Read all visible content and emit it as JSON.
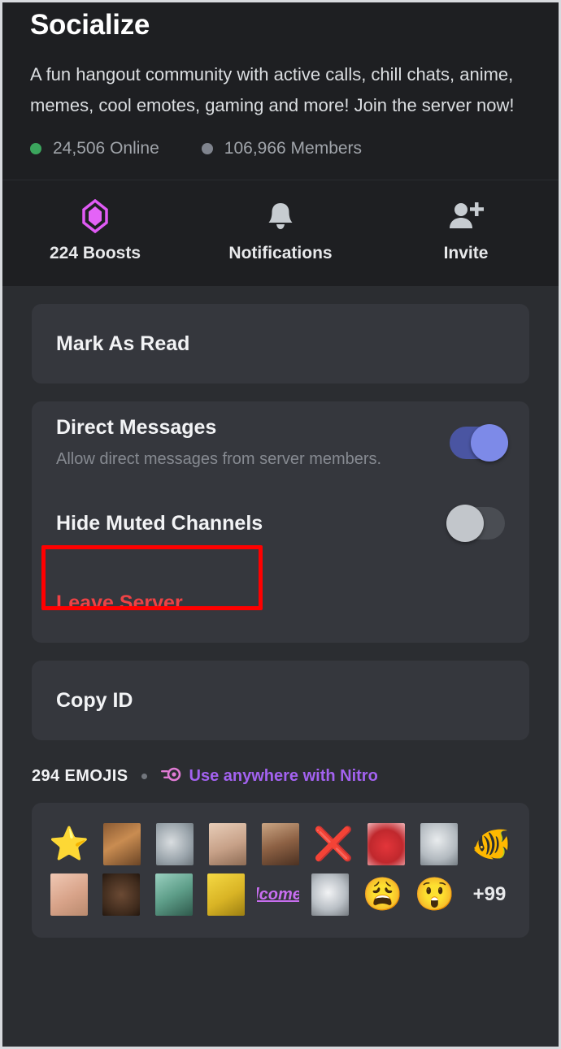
{
  "header": {
    "server_name": "Socialize",
    "description": "A fun hangout community with active calls, chill chats, anime, memes, cool emotes, gaming and more! Join the server now!",
    "stats": [
      {
        "icon": "online-dot-icon",
        "label": "24,506 Online",
        "color": "#3ba55d"
      },
      {
        "icon": "members-dot-icon",
        "label": "106,966 Members",
        "color": "#80848e"
      }
    ]
  },
  "actions": [
    {
      "icon": "boost-gem-icon",
      "label": "224 Boosts",
      "color": "#e05af5"
    },
    {
      "icon": "bell-icon",
      "label": "Notifications",
      "color": "#c7ccd1"
    },
    {
      "icon": "person-add-icon",
      "label": "Invite",
      "color": "#c7ccd1"
    }
  ],
  "settings": {
    "mark_as_read": {
      "label": "Mark As Read"
    },
    "direct_messages": {
      "label": "Direct Messages",
      "sublabel": "Allow direct messages from server members.",
      "toggle_state": "on"
    },
    "hide_muted_channels": {
      "label": "Hide Muted Channels",
      "toggle_state": "off"
    },
    "leave_server": {
      "label": "Leave Server",
      "color": "#ed4245",
      "highlight_color": "#ff0000"
    },
    "copy_id": {
      "label": "Copy ID"
    }
  },
  "emojis": {
    "count_label": "294 EMOJIS",
    "nitro_icon": "nitro-boost-icon",
    "nitro_label": "Use anywhere with Nitro",
    "more_label": "+99",
    "row1": [
      {
        "name": "star-emoji",
        "glyph": "⭐",
        "kind": "glyph"
      },
      {
        "name": "cat-emoji",
        "kind": "photo",
        "style": "ph-cat"
      },
      {
        "name": "fish-emoji",
        "kind": "photo",
        "style": "ph-fish"
      },
      {
        "name": "old-man-emoji",
        "kind": "photo",
        "style": "ph-oldman"
      },
      {
        "name": "smiling-man-emoji",
        "kind": "photo",
        "style": "ph-smile"
      },
      {
        "name": "red-x-emoji",
        "glyph": "❌",
        "kind": "glyph"
      },
      {
        "name": "elmo-emoji",
        "kind": "photo",
        "style": "ph-elmo"
      },
      {
        "name": "thomas-face-emoji",
        "kind": "photo",
        "style": "ph-thomas"
      },
      {
        "name": "clownfish-emoji",
        "glyph": "🐠",
        "kind": "glyph"
      }
    ],
    "row2": [
      {
        "name": "squinting-face-emoji",
        "kind": "photo",
        "style": "ph-eyes"
      },
      {
        "name": "confused-nick-young-emoji",
        "kind": "photo",
        "style": "ph-nick"
      },
      {
        "name": "green-creature-emoji",
        "kind": "photo",
        "style": "ph-meme"
      },
      {
        "name": "homer-emoji",
        "kind": "photo",
        "style": "ph-homer"
      },
      {
        "name": "welcome-text-emoji",
        "kind": "text",
        "text": "lcome"
      },
      {
        "name": "white-blob-emoji",
        "kind": "photo",
        "style": "ph-blob"
      },
      {
        "name": "weary-face-emoji",
        "glyph": "😩",
        "kind": "glyph"
      },
      {
        "name": "astonished-face-emoji",
        "glyph": "😲",
        "kind": "glyph"
      }
    ]
  }
}
